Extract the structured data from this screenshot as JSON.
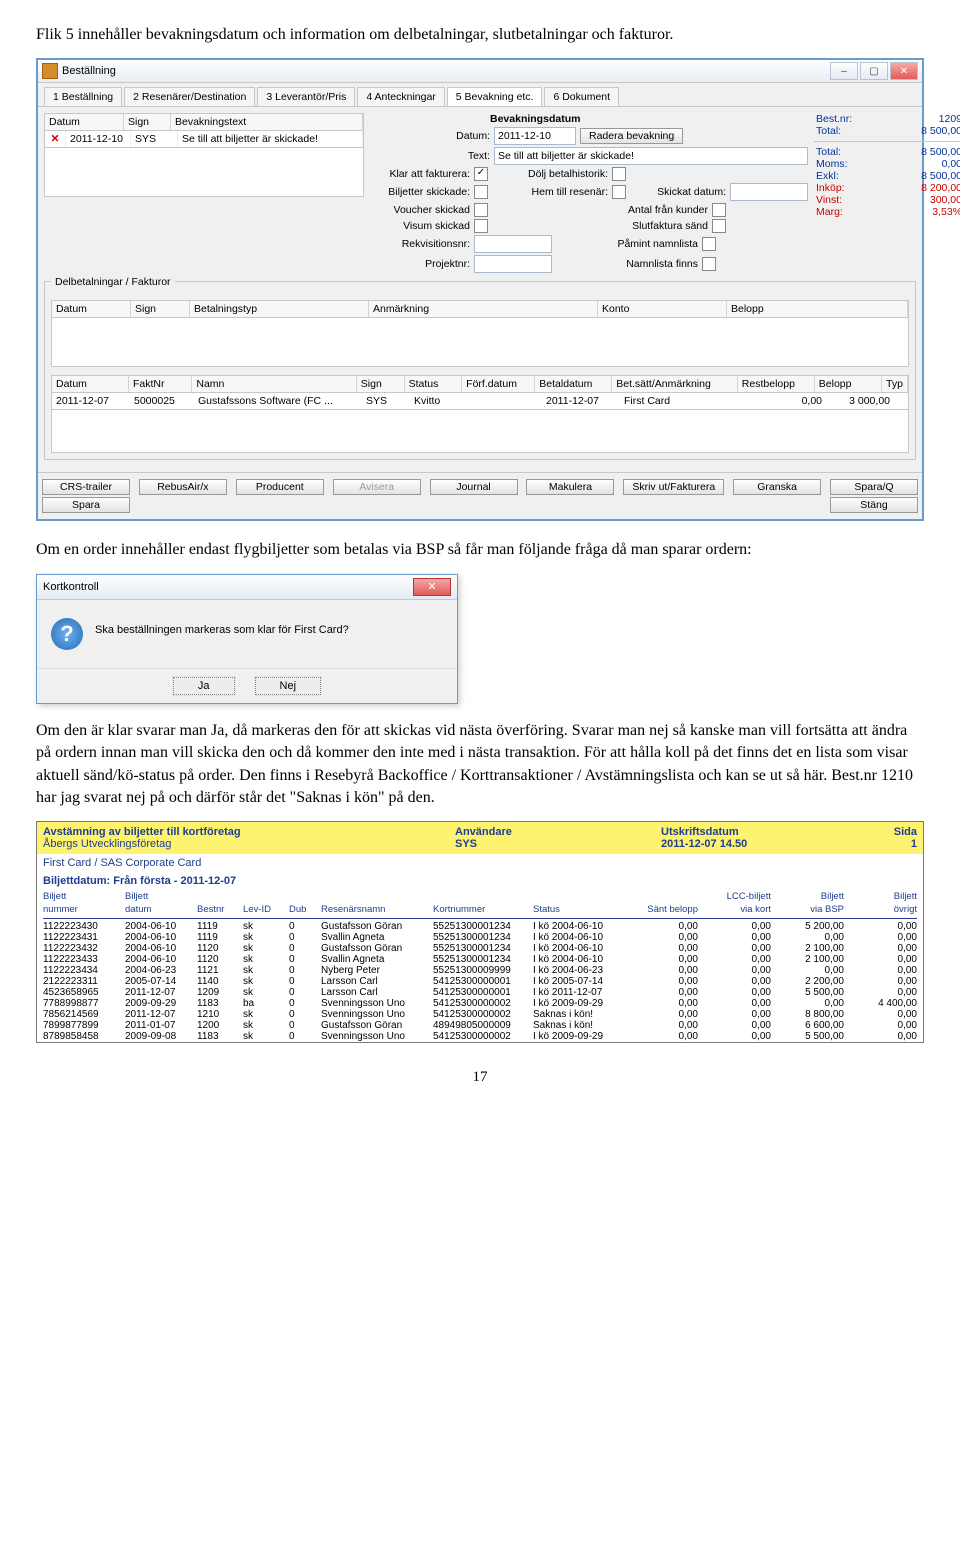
{
  "para1": "Flik 5 innehåller bevakningsdatum och information om delbetalningar, slutbetalningar och fakturor.",
  "para2": "Om en order innehåller endast flygbiljetter som betalas via BSP så får man följande fråga då man sparar ordern:",
  "para3": "Om den är klar svarar man Ja, då markeras den för att skickas vid nästa överföring. Svarar man nej så kanske man vill fortsätta att ändra på ordern innan man vill skicka den och då kommer den inte med i nästa transaktion. För att hålla koll på det finns det en lista som visar aktuell sänd/kö-status på order. Den finns i Resebyrå Backoffice / Korttransaktioner / Avstämningslista och kan se ut så här. Best.nr 1210 har jag svarat nej på och därför står det \"Saknas i kön\" på den.",
  "app": {
    "title": "Beställning",
    "tabs": [
      "1 Beställning",
      "2 Resenärer/Destination",
      "3 Leverantör/Pris",
      "4 Anteckningar",
      "5 Bevakning etc.",
      "6 Dokument"
    ],
    "bev": {
      "head": [
        "Datum",
        "Sign",
        "Bevakningstext"
      ],
      "row": [
        "2011-12-10",
        "SYS",
        "Se till att biljetter är skickade!"
      ]
    },
    "mid": {
      "section": "Bevakningsdatum",
      "datum": "Datum:",
      "datumval": "2011-12-10",
      "radera": "Radera bevakning",
      "text": "Text:",
      "textval": "Se till att biljetter är skickade!",
      "klar": "Klar att fakturera:",
      "dolj": "Dölj betalhistorik:",
      "bilj": "Biljetter skickade:",
      "hem": "Hem till resenär:",
      "skickat": "Skickat datum:",
      "voucher": "Voucher skickad",
      "antal": "Antal från kunder",
      "visum": "Visum skickad",
      "slut": "Slutfaktura sänd",
      "rekv": "Rekvisitionsnr:",
      "pam": "Påmint namnlista",
      "proj": "Projektnr:",
      "namn": "Namnlista finns"
    },
    "tot": {
      "labels": [
        "Best.nr:",
        "Total:",
        "Total:",
        "Moms:",
        "Exkl:",
        "Inköp:",
        "Vinst:",
        "Marg:"
      ],
      "vals": [
        "1209",
        "8 500,00",
        "8 500,00",
        "0,00",
        "8 500,00",
        "8 200,00",
        "300,00",
        "3,53%"
      ]
    },
    "delbet": {
      "legend": "Delbetalningar / Fakturor",
      "head": [
        "Datum",
        "Sign",
        "Betalningstyp",
        "Anmärkning",
        "Konto",
        "Belopp"
      ]
    },
    "fakt": {
      "head": [
        "Datum",
        "FaktNr",
        "Namn",
        "Sign",
        "Status",
        "Förf.datum",
        "Betaldatum",
        "Bet.sätt/Anmärkning",
        "Restbelopp",
        "Belopp",
        "Typ"
      ],
      "row": [
        "2011-12-07",
        "5000025",
        "Gustafssons Software (FC ...",
        "SYS",
        "Kvitto",
        "",
        "2011-12-07",
        "First Card",
        "0,00",
        "3 000,00",
        ""
      ]
    },
    "buttons": [
      "CRS-trailer",
      "RebusAir/x",
      "Producent",
      "Avisera",
      "Journal",
      "Makulera",
      "Skriv ut/Fakturera",
      "Granska",
      "Spara/Q",
      "Spara",
      "Stäng"
    ]
  },
  "dlg": {
    "title": "Kortkontroll",
    "msg": "Ska beställningen markeras som klar för First Card?",
    "ja": "Ja",
    "nej": "Nej"
  },
  "rpt": {
    "title": "Avstämning av biljetter till kortföretag",
    "company": "Åbergs Utvecklingsföretag",
    "anv_lbl": "Användare",
    "anv": "SYS",
    "dat_lbl": "Utskriftsdatum",
    "dat": "2011-12-07 14.50",
    "sid_lbl": "Sida",
    "sid": "1",
    "card": "First Card / SAS Corporate Card",
    "bilj": "Biljettdatum:   Från första   -  2011-12-07",
    "head1": [
      "Biljett",
      "Biljett",
      "",
      "",
      "",
      "",
      "",
      "",
      "",
      "LCC-biljett",
      "Biljett",
      "Biljett"
    ],
    "head2": [
      "nummer",
      "datum",
      "Bestnr",
      "Lev-ID",
      "Dub",
      "Resenärsnamn",
      "Kortnummer",
      "Status",
      "Sänt belopp",
      "via kort",
      "via BSP",
      "övrigt"
    ],
    "rows": [
      [
        "1122223430",
        "2004-06-10",
        "1119",
        "sk",
        "0",
        "Gustafsson Göran",
        "55251300001234",
        "I kö 2004-06-10",
        "0,00",
        "0,00",
        "5 200,00",
        "0,00"
      ],
      [
        "1122223431",
        "2004-06-10",
        "1119",
        "sk",
        "0",
        "Svallin Agneta",
        "55251300001234",
        "I kö 2004-06-10",
        "0,00",
        "0,00",
        "0,00",
        "0,00"
      ],
      [
        "1122223432",
        "2004-06-10",
        "1120",
        "sk",
        "0",
        "Gustafsson Göran",
        "55251300001234",
        "I kö 2004-06-10",
        "0,00",
        "0,00",
        "2 100,00",
        "0,00"
      ],
      [
        "1122223433",
        "2004-06-10",
        "1120",
        "sk",
        "0",
        "Svallin Agneta",
        "55251300001234",
        "I kö 2004-06-10",
        "0,00",
        "0,00",
        "2 100,00",
        "0,00"
      ],
      [
        "1122223434",
        "2004-06-23",
        "1121",
        "sk",
        "0",
        "Nyberg Peter",
        "55251300009999",
        "I kö 2004-06-23",
        "0,00",
        "0,00",
        "0,00",
        "0,00"
      ],
      [
        "2122223311",
        "2005-07-14",
        "1140",
        "sk",
        "0",
        "Larsson Carl",
        "54125300000001",
        "I kö 2005-07-14",
        "0,00",
        "0,00",
        "2 200,00",
        "0,00"
      ],
      [
        "4523658965",
        "2011-12-07",
        "1209",
        "sk",
        "0",
        "Larsson Carl",
        "54125300000001",
        "I kö 2011-12-07",
        "0,00",
        "0,00",
        "5 500,00",
        "0,00"
      ],
      [
        "7788998877",
        "2009-09-29",
        "1183",
        "ba",
        "0",
        "Svenningsson Uno",
        "54125300000002",
        "I kö 2009-09-29",
        "0,00",
        "0,00",
        "0,00",
        "4 400,00"
      ],
      [
        "7856214569",
        "2011-12-07",
        "1210",
        "sk",
        "0",
        "Svenningsson Uno",
        "54125300000002",
        "Saknas i kön!",
        "0,00",
        "0,00",
        "8 800,00",
        "0,00"
      ],
      [
        "7899877899",
        "2011-01-07",
        "1200",
        "sk",
        "0",
        "Gustafsson Göran",
        "48949805000009",
        "Saknas i kön!",
        "0,00",
        "0,00",
        "6 600,00",
        "0,00"
      ],
      [
        "8789858458",
        "2009-09-08",
        "1183",
        "sk",
        "0",
        "Svenningsson Uno",
        "54125300000002",
        "I kö 2009-09-29",
        "0,00",
        "0,00",
        "5 500,00",
        "0,00"
      ]
    ]
  },
  "pagenum": "17"
}
